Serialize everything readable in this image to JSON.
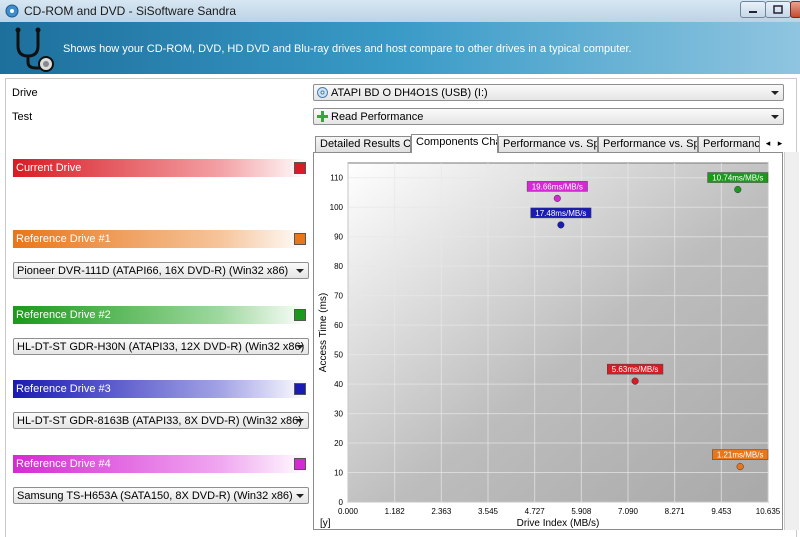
{
  "window": {
    "title": "CD-ROM and DVD - SiSoftware Sandra"
  },
  "banner": {
    "description": "Shows how your CD-ROM, DVD, HD DVD and Blu-ray drives and host compare to other drives in a typical computer."
  },
  "form": {
    "drive_label": "Drive",
    "drive_value": "ATAPI BD  O  DH4O1S (USB) (I:)",
    "test_label": "Test",
    "test_value": "Read Performance"
  },
  "drives": {
    "current": {
      "label": "Current Drive",
      "color": "#d81b24"
    },
    "ref1": {
      "label": "Reference Drive #1",
      "color": "#e8761a",
      "select": "Pioneer DVR-111D (ATAPI66, 16X DVD-R) (Win32 x86)"
    },
    "ref2": {
      "label": "Reference Drive #2",
      "color": "#1a9a1a",
      "select": "HL-DT-ST GDR-H30N (ATAPI33, 12X DVD-R) (Win32 x86)"
    },
    "ref3": {
      "label": "Reference Drive #3",
      "color": "#1a1ab4",
      "select": "HL-DT-ST GDR-8163B (ATAPI33, 8X DVD-R) (Win32 x86)"
    },
    "ref4": {
      "label": "Reference Drive #4",
      "color": "#d42ad4",
      "select": "Samsung TS-H653A (SATA150, 8X DVD-R) (Win32 x86)"
    }
  },
  "tabs": [
    "Detailed Results Chart",
    "Components Chart",
    "Performance vs. Speed",
    "Performance vs. Speed",
    "Performance v"
  ],
  "active_tab": 1,
  "chart_data": {
    "type": "scatter",
    "xlabel": "Drive Index (MB/s)",
    "ylabel": "Access Time (ms)",
    "corner_label": "[y]",
    "xlim": [
      0,
      10.635
    ],
    "ylim": [
      0,
      115
    ],
    "x_ticks": [
      "0.000",
      "1.182",
      "2.363",
      "3.545",
      "4.727",
      "5.908",
      "7.090",
      "8.271",
      "9.453",
      "10.635"
    ],
    "y_ticks": [
      0,
      10,
      20,
      30,
      40,
      50,
      60,
      70,
      80,
      90,
      100,
      110
    ],
    "points": [
      {
        "name": "Current Drive",
        "x": 7.27,
        "y": 41,
        "label": "5.63ms/MB/s",
        "color": "#d81b24"
      },
      {
        "name": "Reference Drive #1",
        "x": 9.93,
        "y": 12,
        "label": "1.21ms/MB/s",
        "color": "#e8761a"
      },
      {
        "name": "Reference Drive #2",
        "x": 9.87,
        "y": 106,
        "label": "10.74ms/MB/s",
        "color": "#1a9a1a"
      },
      {
        "name": "Reference Drive #3",
        "x": 5.39,
        "y": 94,
        "label": "17.48ms/MB/s",
        "color": "#1a1ab4"
      },
      {
        "name": "Reference Drive #4",
        "x": 5.3,
        "y": 103,
        "label": "19.66ms/MB/s",
        "color": "#d42ad4"
      }
    ]
  }
}
